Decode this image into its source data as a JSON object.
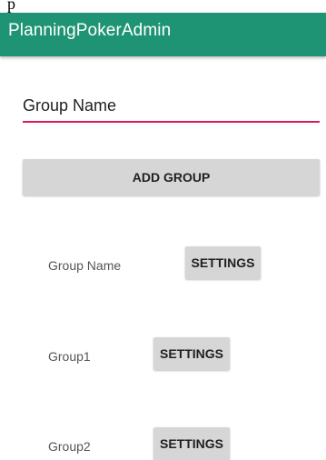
{
  "page_caption": "p",
  "app": {
    "title": "PlanningPokerAdmin"
  },
  "form": {
    "group_name_value": "Group Name",
    "add_group_label": "ADD GROUP"
  },
  "groups": [
    {
      "name": "Group Name",
      "settings_label": "SETTINGS"
    },
    {
      "name": "Group1",
      "settings_label": "SETTINGS"
    },
    {
      "name": "Group2",
      "settings_label": "SETTINGS"
    }
  ],
  "colors": {
    "app_bar": "#1e9474",
    "input_underline": "#d81b60",
    "button_bg": "#d6d6d6"
  }
}
